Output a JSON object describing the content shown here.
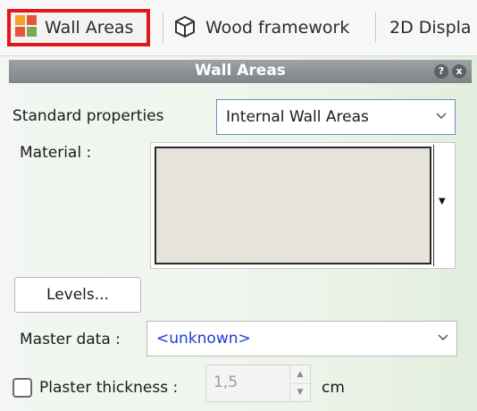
{
  "toolbar": {
    "tabs": [
      {
        "label": "Wall Areas",
        "icon": "wall-areas-icon",
        "active": true
      },
      {
        "label": "Wood framework",
        "icon": "wood-framework-icon",
        "active": false
      },
      {
        "label": "2D Displa",
        "icon": "",
        "active": false
      }
    ],
    "active_highlight_color": "#e2161b"
  },
  "panel": {
    "title": "Wall Areas",
    "help_button": "?",
    "close_button": "x",
    "standard_properties": {
      "label": "Standard properties",
      "value": "Internal Wall Areas"
    },
    "material": {
      "label": "Material :",
      "swatch_color": "#e6e3da"
    },
    "levels_button": "Levels...",
    "master_data": {
      "label": "Master data :",
      "value": "<unknown>",
      "value_color": "#1f3bd6"
    },
    "plaster": {
      "checkbox_label": "Plaster thickness :",
      "checked": false,
      "value": "1,5",
      "unit": "cm"
    }
  }
}
